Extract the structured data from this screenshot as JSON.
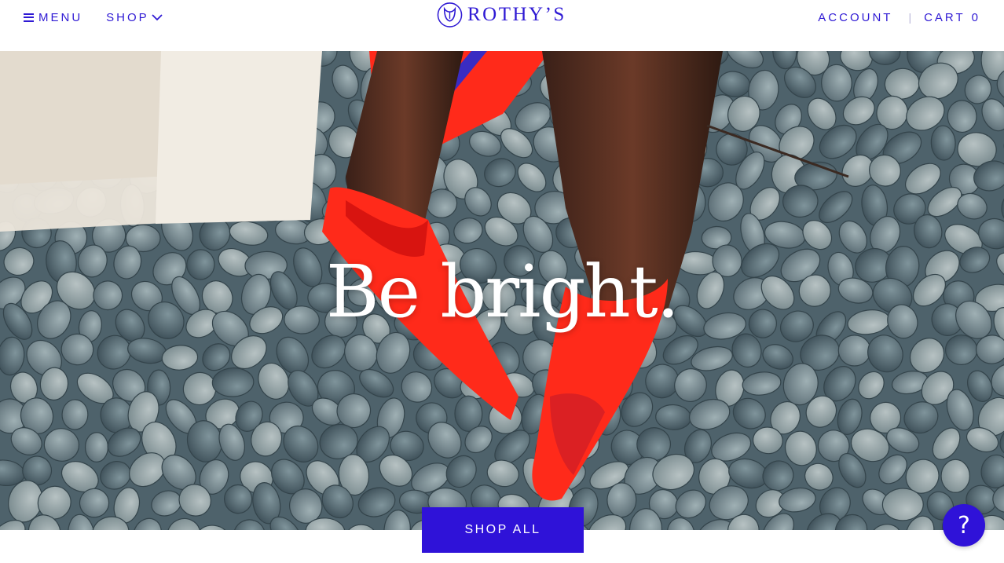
{
  "header": {
    "menu_label": "MENU",
    "shop_label": "SHOP",
    "brand": "ROTHY’S",
    "account_label": "ACCOUNT",
    "separator": "|",
    "cart_label": "CART",
    "cart_count": "0"
  },
  "hero": {
    "headline": "Be bright.",
    "cta_label": "SHOP ALL"
  },
  "help": {
    "label": "?"
  },
  "colors": {
    "brand": "#2f1ad4",
    "cta": "#2f12d8",
    "shoe": "#ff2a1a"
  },
  "icons": [
    "hamburger-icon",
    "chevron-down-icon",
    "logo-icon",
    "help-icon"
  ]
}
